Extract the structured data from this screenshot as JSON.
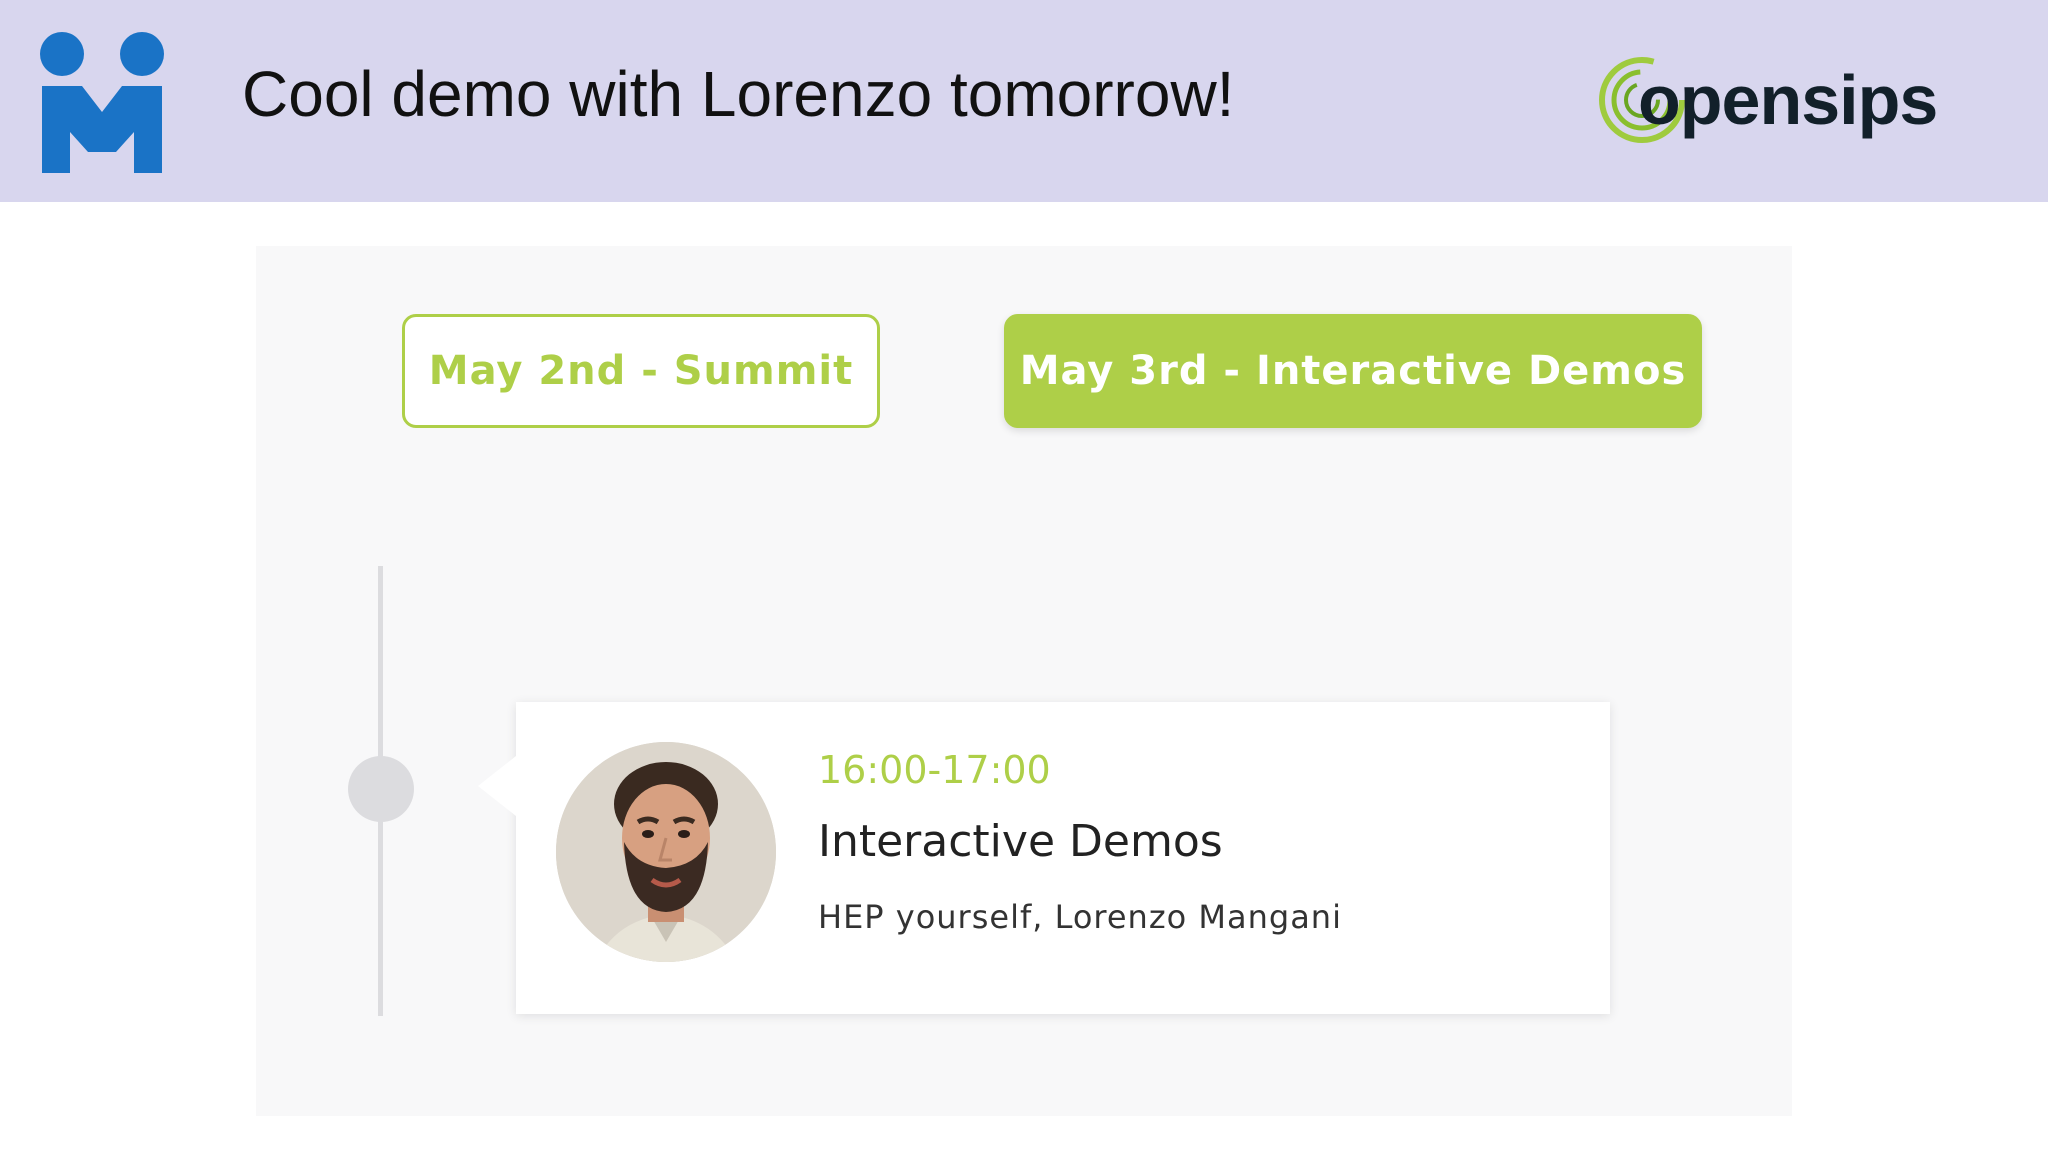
{
  "header": {
    "title": "Cool demo with Lorenzo tomorrow!",
    "left_logo_icon": "hepic-logo-icon",
    "right_logo_text": "opensips",
    "background": "#d8d6ee"
  },
  "schedule": {
    "tabs": [
      {
        "label": "May 2nd - Summit",
        "active": false
      },
      {
        "label": "May 3rd - Interactive Demos",
        "active": true
      }
    ],
    "accent_color": "#aecf48",
    "session": {
      "time": "16:00-17:00",
      "title": "Interactive Demos",
      "speaker_line": "HEP yourself, Lorenzo Mangani",
      "avatar_icon": "speaker-avatar"
    }
  }
}
